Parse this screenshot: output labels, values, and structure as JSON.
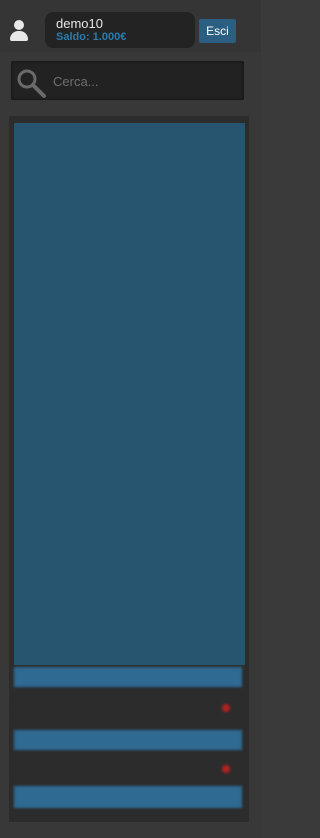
{
  "header": {
    "username": "demo10",
    "balance": "Saldo: 1.000€",
    "logout_label": "Esci"
  },
  "search": {
    "placeholder": "Cerca..."
  },
  "events": [
    {
      "header": "",
      "rows": [
        {
          "c1": "",
          "c2": "",
          "c3": ""
        }
      ]
    },
    {
      "header": "",
      "rows": [
        {
          "c1": "",
          "c2": "",
          "c3": ""
        }
      ]
    }
  ],
  "footer": {
    "button_label": ""
  },
  "colors": {
    "accent": "#2b5f82",
    "balance_text": "#2a7bb0",
    "content_blue": "#27546e",
    "status_dot": "#b22222"
  }
}
